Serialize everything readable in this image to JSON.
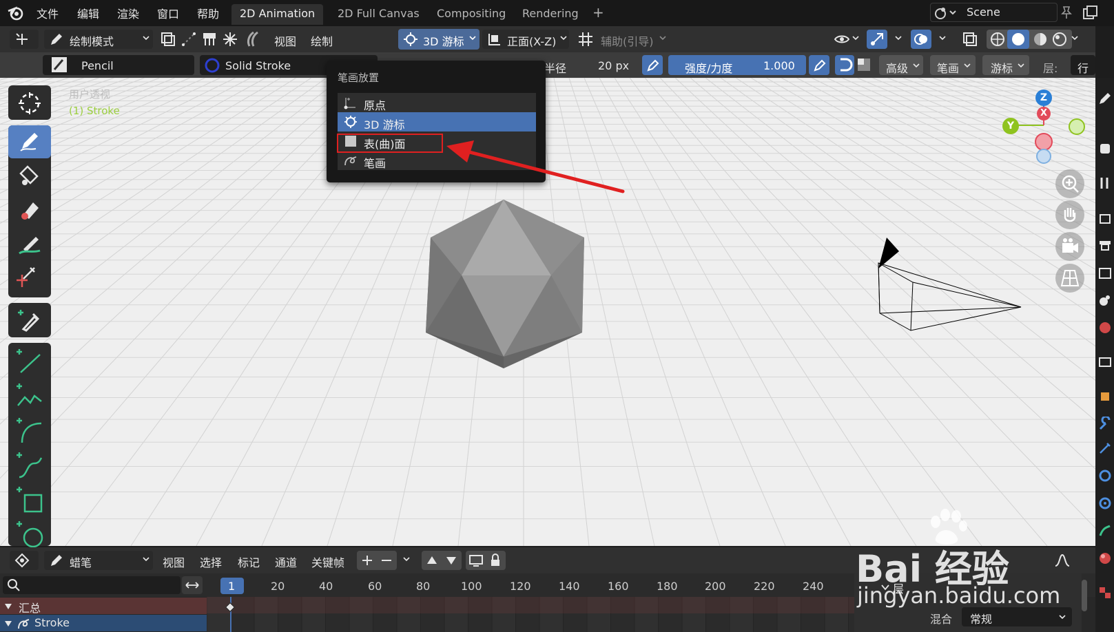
{
  "menu": {
    "items": [
      "文件",
      "编辑",
      "渲染",
      "窗口",
      "帮助"
    ]
  },
  "workspaces": {
    "tabs": [
      "2D Animation",
      "2D Full Canvas",
      "Compositing",
      "Rendering"
    ],
    "active": "2D Animation",
    "add": "+"
  },
  "scene": {
    "name": "Scene"
  },
  "header": {
    "mode": "绘制模式",
    "view": "视图",
    "draw": "绘制",
    "placement": "3D 游标",
    "orientation": "正面(X-Z)",
    "guides": "辅助(引导)"
  },
  "tool_settings": {
    "brush": "Pencil",
    "material": "Solid Stroke",
    "radius_label": "半径",
    "radius_value": "20 px",
    "strength_label": "强度/力度",
    "strength_value": "1.000",
    "advanced": "高级",
    "stroke": "笔画",
    "cursor": "游标",
    "layer": "层:",
    "row": "行"
  },
  "viewport": {
    "view_name": "用户透视",
    "object_name": "(1) Stroke",
    "gizmo": {
      "z": "Z",
      "x": "X",
      "y": "Y"
    }
  },
  "popup": {
    "title": "笔画放置",
    "items": [
      "原点",
      "3D 游标",
      "表(曲)面",
      "笔画"
    ],
    "selected": "3D 游标",
    "highlighted": "表(曲)面"
  },
  "timeline": {
    "mode": "蜡笔",
    "menus": [
      "视图",
      "选择",
      "标记",
      "通道",
      "关键帧"
    ],
    "current_frame": "1",
    "ticks": [
      "20",
      "40",
      "60",
      "80",
      "100",
      "120",
      "140",
      "160",
      "180",
      "200",
      "220",
      "240"
    ],
    "channels": [
      "汇总",
      "Stroke"
    ],
    "layer_panel_title": "层",
    "blend_label": "混合",
    "blend_value": "常规"
  },
  "watermark": {
    "brand": "Bai 经验",
    "url": "jingyan.baidu.com"
  },
  "colors": {
    "accent_blue": "#4772b3",
    "red_annotation": "#e02020",
    "axis_z": "#2a7fd6",
    "axis_x": "#e24a5a",
    "axis_y": "#8fc31f",
    "object_label": "#9ccf3f"
  }
}
